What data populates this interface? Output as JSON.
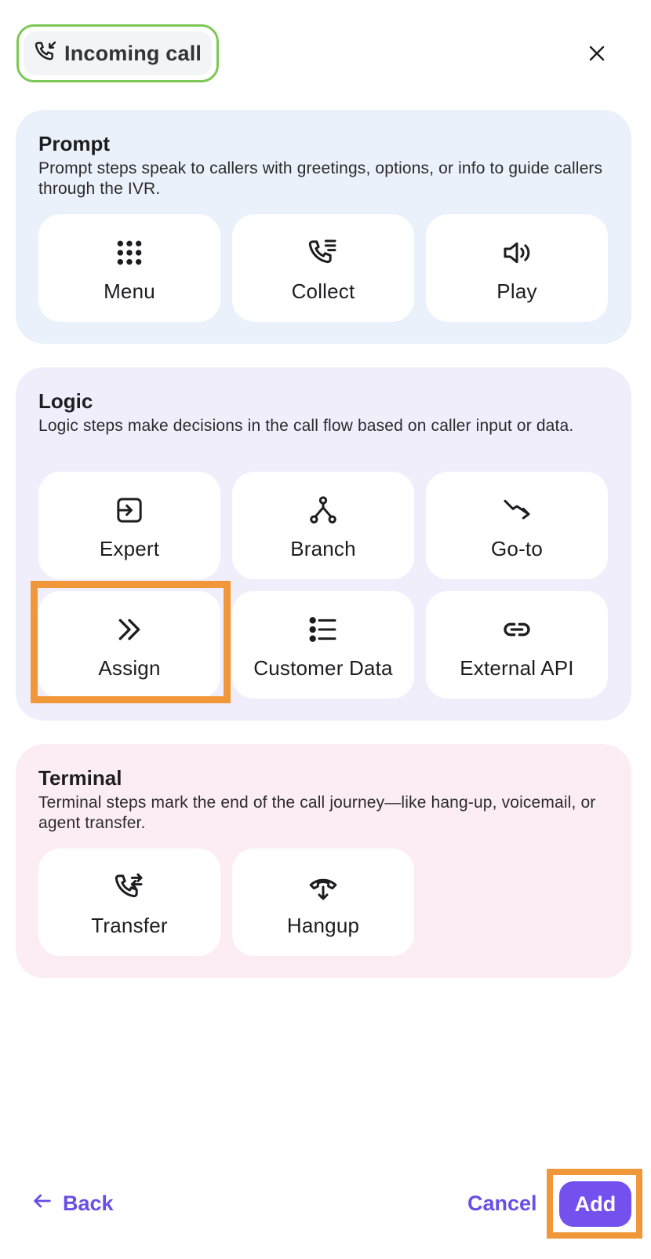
{
  "header": {
    "trigger_label": "Incoming call",
    "trigger_icon": "phone-incoming-icon",
    "close_icon": "close-icon"
  },
  "sections": [
    {
      "title": "Prompt",
      "description": "Prompt steps speak to callers with greetings, options, or info to guide callers through the IVR.",
      "color": "#ebf1fa",
      "items": [
        {
          "label": "Menu",
          "icon": "grid-dots-icon"
        },
        {
          "label": "Collect",
          "icon": "phone-list-icon"
        },
        {
          "label": "Play",
          "icon": "speaker-icon"
        }
      ]
    },
    {
      "title": "Logic",
      "description": "Logic steps make decisions in the call flow based on caller input or data.",
      "color": "#f1eefc",
      "items": [
        {
          "label": "Expert",
          "icon": "sign-in-icon"
        },
        {
          "label": "Branch",
          "icon": "branch-icon"
        },
        {
          "label": "Go-to",
          "icon": "goto-arrow-icon"
        },
        {
          "label": "Assign",
          "icon": "double-chevron-right-icon"
        },
        {
          "label": "Customer Data",
          "icon": "list-icon"
        },
        {
          "label": "External API",
          "icon": "link-icon"
        }
      ]
    },
    {
      "title": "Terminal",
      "description": "Terminal steps mark the end of the call journey—like hang-up, voicemail, or agent transfer.",
      "color": "#fcedf5",
      "items": [
        {
          "label": "Transfer",
          "icon": "phone-transfer-icon"
        },
        {
          "label": "Hangup",
          "icon": "hangup-icon"
        }
      ]
    }
  ],
  "footer": {
    "back_label": "Back",
    "cancel_label": "Cancel",
    "add_label": "Add"
  },
  "colors": {
    "accent": "#7451ee",
    "link": "#6a4ee6",
    "highlight": "#f0973a",
    "trigger_border": "#7cc755"
  }
}
